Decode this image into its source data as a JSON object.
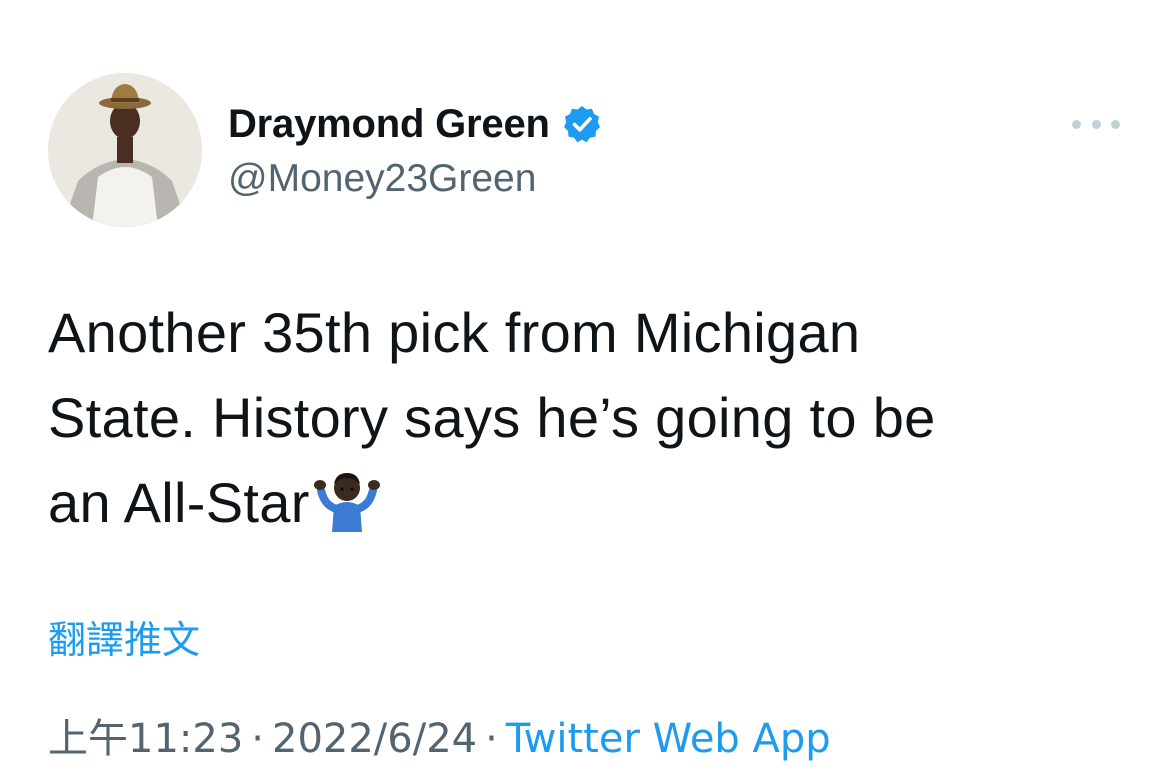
{
  "author": {
    "display_name": "Draymond Green",
    "handle": "@Money23Green",
    "verified": true
  },
  "tweet": {
    "text": "Another 35th pick from Michigan\nState. History says he’s going to be\nan All-Star",
    "emoji": "person-shrugging"
  },
  "translate_link": "翻譯推文",
  "meta": {
    "time": "上午11:23",
    "separator": "·",
    "date": "2022/6/24",
    "source": "Twitter Web App"
  },
  "colors": {
    "accent": "#1d9bf0",
    "secondary_text": "#536471",
    "primary_text": "#0f1419"
  },
  "icons": [
    "avatar",
    "verified-badge-icon",
    "more-options-icon",
    "shrug-emoji-icon"
  ]
}
